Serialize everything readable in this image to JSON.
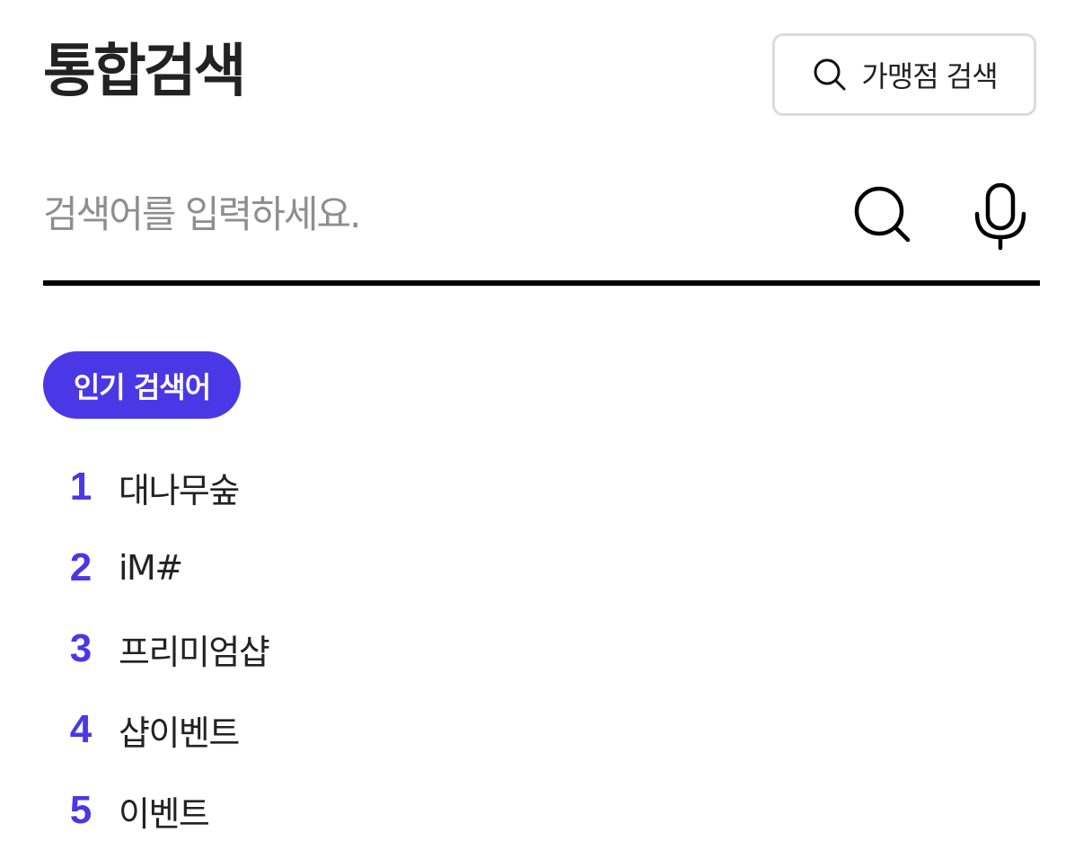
{
  "header": {
    "title": "통합검색",
    "store_search_label": "가맹점 검색",
    "store_search_icon": "search-icon"
  },
  "search": {
    "placeholder": "검색어를 입력하세요.",
    "value": "",
    "submit_icon": "search-icon",
    "voice_icon": "microphone-icon"
  },
  "popular": {
    "badge_label": "인기 검색어",
    "items": [
      {
        "rank": "1",
        "keyword": "대나무숲"
      },
      {
        "rank": "2",
        "keyword": "iM#"
      },
      {
        "rank": "3",
        "keyword": "프리미엄샵"
      },
      {
        "rank": "4",
        "keyword": "샵이벤트"
      },
      {
        "rank": "5",
        "keyword": "이벤트"
      }
    ]
  },
  "colors": {
    "accent": "#4a38e6",
    "text": "#222222",
    "placeholder": "#8e8e8e",
    "underline": "#000000",
    "button_border": "#dcdcdc"
  }
}
